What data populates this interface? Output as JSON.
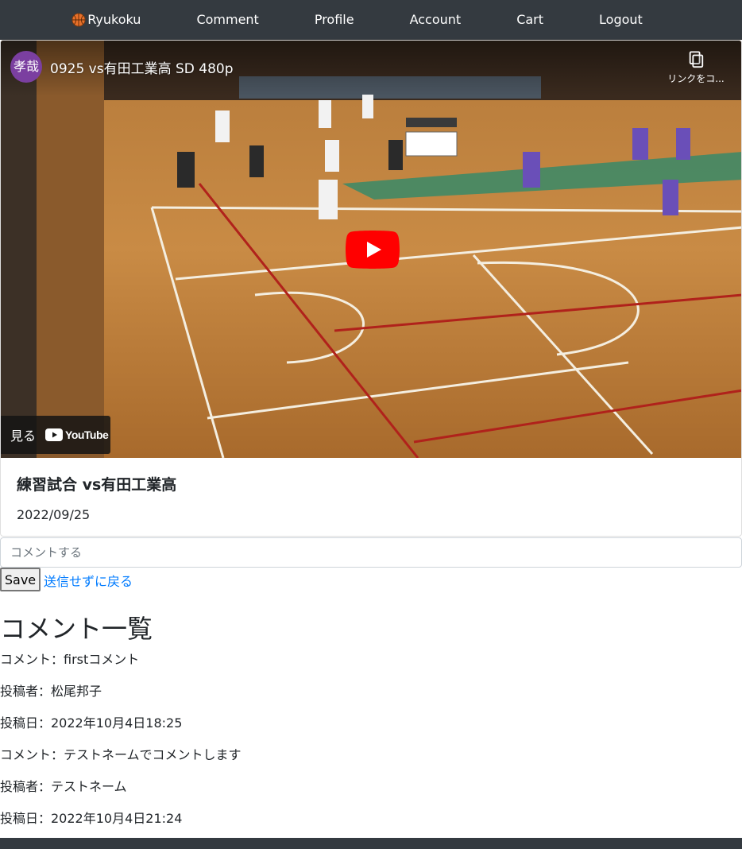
{
  "nav": {
    "brand_label": "Ryukoku",
    "brand_icon": "basketball-icon",
    "items": [
      {
        "label": "Comment"
      },
      {
        "label": "Profile"
      },
      {
        "label": "Account"
      },
      {
        "label": "Cart"
      },
      {
        "label": "Logout"
      }
    ]
  },
  "video": {
    "channel_avatar": "孝哉",
    "title": "0925 vs有田工業高 SD 480p",
    "copy_label": "リンクをコ...",
    "watch_label": "見る",
    "youtube_label": "YouTube"
  },
  "post": {
    "title": "練習試合 vs有田工業高",
    "date": "2022/09/25"
  },
  "comment_form": {
    "placeholder": "コメントする",
    "save_label": "Save",
    "back_label": "送信せずに戻る"
  },
  "comments_section": {
    "heading": "コメント一覧",
    "comments": [
      {
        "comment": "コメント：firstコメント",
        "author": "投稿者：松尾邦子",
        "date": "投稿日：2022年10月4日18:25"
      },
      {
        "comment": "コメント：テストネームでコメントします",
        "author": "投稿者：テストネーム",
        "date": "投稿日：2022年10月4日21:24"
      }
    ]
  },
  "colors": {
    "navbar": "#343a40",
    "link": "#007bff",
    "youtube_red": "#ff0000"
  }
}
